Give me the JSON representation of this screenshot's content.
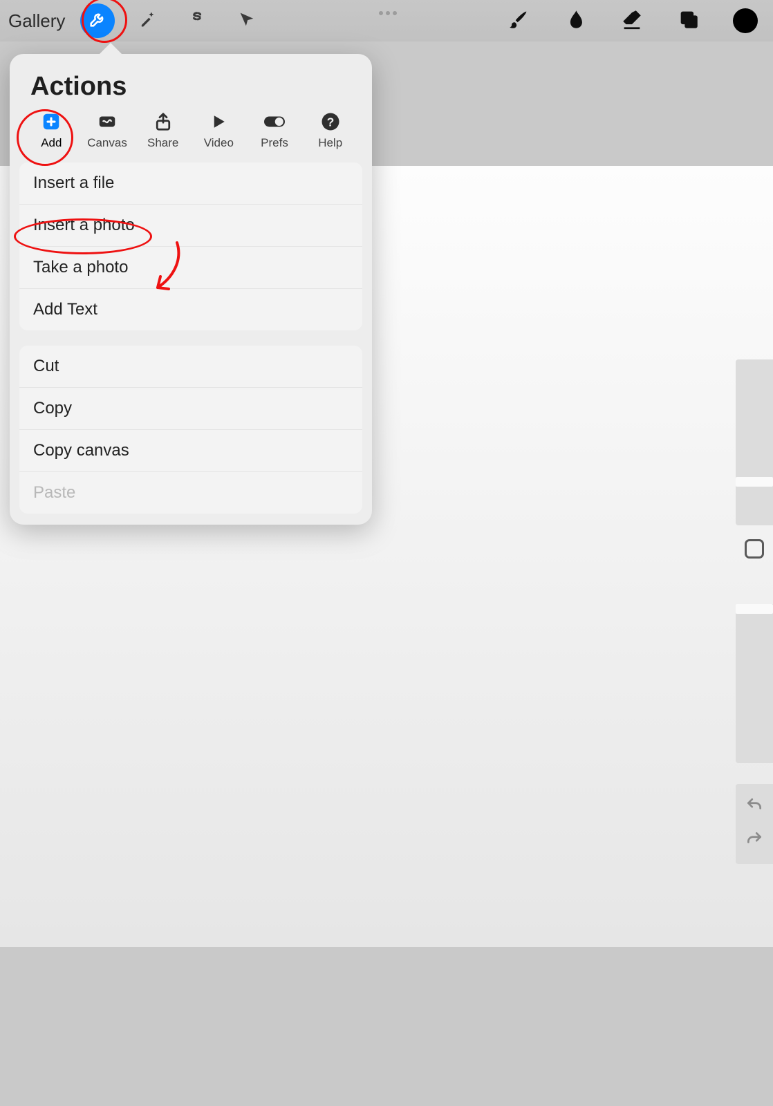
{
  "toolbar": {
    "gallery_label": "Gallery",
    "color_swatch": "#000000"
  },
  "popover": {
    "title": "Actions",
    "tabs": [
      {
        "label": "Add"
      },
      {
        "label": "Canvas"
      },
      {
        "label": "Share"
      },
      {
        "label": "Video"
      },
      {
        "label": "Prefs"
      },
      {
        "label": "Help"
      }
    ],
    "group1": [
      "Insert a file",
      "Insert a photo",
      "Take a photo",
      "Add Text"
    ],
    "group2": [
      "Cut",
      "Copy",
      "Copy canvas",
      "Paste"
    ],
    "disabled_items": [
      "Paste"
    ]
  },
  "annotation_color": "#e11"
}
